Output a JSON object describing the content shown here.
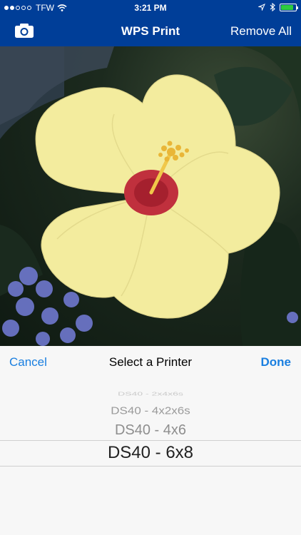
{
  "status_bar": {
    "carrier": "TFW",
    "time": "3:21 PM",
    "battery_level": 0.85
  },
  "nav": {
    "title": "WPS Print",
    "remove_all": "Remove All"
  },
  "picker": {
    "cancel": "Cancel",
    "title": "Select a Printer",
    "done": "Done",
    "options": [
      "DS40 - 2x4x6s",
      "DS40 - 4x2x6s",
      "DS40 - 4x6",
      "DS40 - 6x8"
    ],
    "selected": "DS40 - 6x8"
  },
  "colors": {
    "nav_background": "#003e98",
    "accent": "#1a7fe0",
    "flower": "#f3ec9e"
  },
  "icons": [
    "camera-icon",
    "wifi-icon",
    "location-icon",
    "bluetooth-icon",
    "battery-icon"
  ]
}
